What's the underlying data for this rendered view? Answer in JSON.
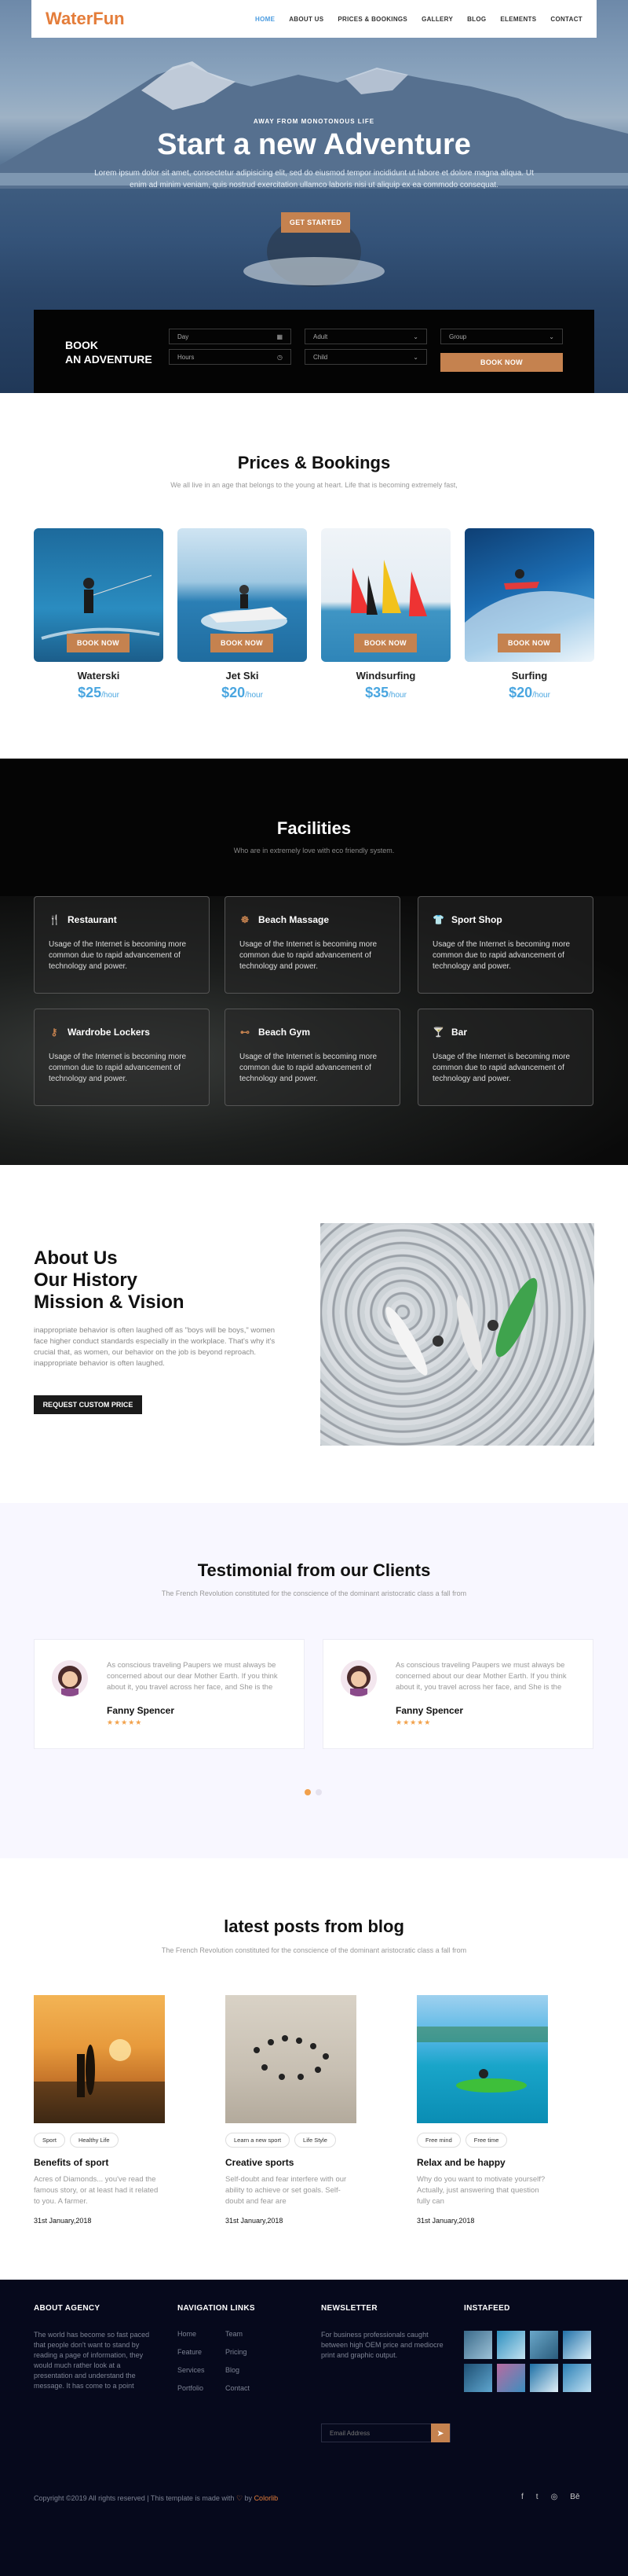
{
  "brand": {
    "logo": "WaterFun",
    "accent": "#c5824f",
    "logo_color": "#e47d3a"
  },
  "nav": [
    "HOME",
    "ABOUT US",
    "PRICES & BOOKINGS",
    "GALLERY",
    "BLOG",
    "ELEMENTS",
    "CONTACT"
  ],
  "hero": {
    "subtitle": "AWAY FROM MONOTONOUS LIFE",
    "title": "Start a new Adventure",
    "text": "Lorem ipsum dolor sit amet, consectetur adipisicing elit, sed do eiusmod tempor incididunt ut labore et dolore magna aliqua. Ut enim ad minim veniam, quis nostrud exercitation ullamco laboris nisi ut aliquip ex ea commodo consequat.",
    "button": "GET STARTED"
  },
  "booking": {
    "title_line1": "BOOK",
    "title_line2": "AN ADVENTURE",
    "day_placeholder": "Day",
    "hours_placeholder": "Hours",
    "adult_select": "Adult",
    "child_select": "Child",
    "group_select": "Group",
    "button": "BOOK NOW"
  },
  "prices": {
    "title": "Prices & Bookings",
    "subtitle": "We all live in an age that belongs to the young at heart. Life that is becoming extremely fast,",
    "button": "BOOK NOW",
    "items": [
      {
        "name": "Waterski",
        "price": "$25",
        "unit": "/hour"
      },
      {
        "name": "Jet Ski",
        "price": "$20",
        "unit": "/hour"
      },
      {
        "name": "Windsurfing",
        "price": "$35",
        "unit": "/hour"
      },
      {
        "name": "Surfing",
        "price": "$20",
        "unit": "/hour"
      }
    ]
  },
  "facilities": {
    "title": "Facilities",
    "subtitle": "Who are in extremely love with eco friendly system.",
    "items": [
      {
        "name": "Restaurant",
        "icon": "restaurant-icon",
        "glyph": "🍴",
        "text": "Usage of the Internet is becoming more common due to rapid advancement of technology and power."
      },
      {
        "name": "Beach Massage",
        "icon": "massage-icon",
        "glyph": "☸",
        "text": "Usage of the Internet is becoming more common due to rapid advancement of technology and power."
      },
      {
        "name": "Sport Shop",
        "icon": "shirt-icon",
        "glyph": "👕",
        "text": "Usage of the Internet is becoming more common due to rapid advancement of technology and power."
      },
      {
        "name": "Wardrobe Lockers",
        "icon": "key-icon",
        "glyph": "⚷",
        "text": "Usage of the Internet is becoming more common due to rapid advancement of technology and power."
      },
      {
        "name": "Beach Gym",
        "icon": "dumbbell-icon",
        "glyph": "⊷",
        "text": "Usage of the Internet is becoming more common due to rapid advancement of technology and power."
      },
      {
        "name": "Bar",
        "icon": "bar-icon",
        "glyph": "🍸",
        "text": "Usage of the Internet is becoming more common due to rapid advancement of technology and power."
      }
    ]
  },
  "about": {
    "title_line1": "About Us",
    "title_line2": "Our History",
    "title_line3": "Mission & Vision",
    "text": "inappropriate behavior is often laughed off as \"boys will be boys,\" women face higher conduct standards especially in the workplace. That's why it's crucial that, as women, our behavior on the job is beyond reproach. inappropriate behavior is often laughed.",
    "button": "REQUEST CUSTOM PRICE"
  },
  "testimonials": {
    "title": "Testimonial from our Clients",
    "subtitle": "The French Revolution constituted for the conscience of the dominant aristocratic class a fall from",
    "items": [
      {
        "text": "As conscious traveling Paupers we must always be concerned about our dear Mother Earth. If you think about it, you travel across her face, and She is the",
        "name": "Fanny Spencer",
        "stars": "★★★★★"
      },
      {
        "text": "As conscious traveling Paupers we must always be concerned about our dear Mother Earth. If you think about it, you travel across her face, and She is the",
        "name": "Fanny Spencer",
        "stars": "★★★★★"
      }
    ]
  },
  "blog": {
    "title": "latest posts from blog",
    "subtitle": "The French Revolution constituted for the conscience of the dominant aristocratic class a fall from",
    "posts": [
      {
        "tags": [
          "Sport",
          "Healthy Life"
        ],
        "title": "Benefits of sport",
        "text": "Acres of Diamonds... you've read the famous story, or at least had it related to you. A farmer.",
        "date": "31st January,2018"
      },
      {
        "tags": [
          "Learn a new sport",
          "Life Style"
        ],
        "title": "Creative sports",
        "text": "Self-doubt and fear interfere with our ability to achieve or set goals. Self-doubt and fear are",
        "date": "31st January,2018"
      },
      {
        "tags": [
          "Free mind",
          "Free time"
        ],
        "title": "Relax and be happy",
        "text": "Why do you want to motivate yourself? Actually, just answering that question fully can",
        "date": "31st January,2018"
      }
    ]
  },
  "footer": {
    "about_title": "ABOUT AGENCY",
    "about_text": "The world has become so fast paced that people don't want to stand by reading a page of information, they would much rather look at a presentation and understand the message. It has come to a point",
    "nav_title": "NAVIGATION LINKS",
    "nav_col1": [
      "Home",
      "Feature",
      "Services",
      "Portfolio"
    ],
    "nav_col2": [
      "Team",
      "Pricing",
      "Blog",
      "Contact"
    ],
    "news_title": "NEWSLETTER",
    "news_text": "For business professionals caught between high OEM price and mediocre print and graphic output.",
    "email_placeholder": "Email Address",
    "insta_title": "INSTAFEED",
    "copyright_prefix": "Copyright ©2019 All rights reserved | This template is made with",
    "copyright_by": "by",
    "copyright_brand": "Colorlib",
    "socials": [
      "f",
      "t",
      "◎",
      "Bē"
    ]
  }
}
